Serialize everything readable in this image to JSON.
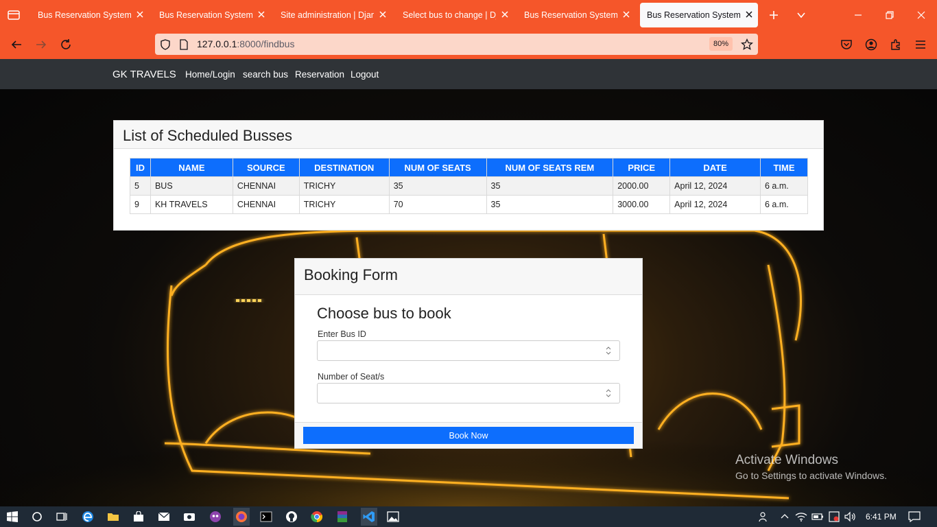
{
  "browser": {
    "tabs": [
      {
        "label": "Bus Reservation System in",
        "active": false
      },
      {
        "label": "Bus Reservation System in",
        "active": false
      },
      {
        "label": "Site administration | Django",
        "active": false
      },
      {
        "label": "Select bus to change | Djan",
        "active": false
      },
      {
        "label": "Bus Reservation System in",
        "active": false
      },
      {
        "label": "Bus Reservation System in",
        "active": true
      }
    ],
    "url_host": "127.0.0.1",
    "url_path": ":8000/findbus",
    "zoom": "80%",
    "theme_color": "#f5562a"
  },
  "site": {
    "brand": "GK TRAVELS",
    "nav": [
      "Home/Login",
      "search bus",
      "Reservation",
      "Logout"
    ]
  },
  "bus_list": {
    "title": "List of Scheduled Busses",
    "columns": [
      "ID",
      "NAME",
      "SOURCE",
      "DESTINATION",
      "NUM OF SEATS",
      "NUM OF SEATS REM",
      "PRICE",
      "DATE",
      "TIME"
    ],
    "rows": [
      [
        "5",
        "BUS",
        "CHENNAI",
        "TRICHY",
        "35",
        "35",
        "2000.00",
        "April 12, 2024",
        "6 a.m."
      ],
      [
        "9",
        "KH TRAVELS",
        "CHENNAI",
        "TRICHY",
        "70",
        "35",
        "3000.00",
        "April 12, 2024",
        "6 a.m."
      ]
    ],
    "header_color": "#0d6efd"
  },
  "booking_form": {
    "title": "Booking Form",
    "subtitle": "Choose bus to book",
    "bus_id_label": "Enter Bus ID",
    "bus_id_value": "",
    "seats_label": "Number of Seat/s",
    "seats_value": "",
    "submit_label": "Book Now"
  },
  "watermark": {
    "line1": "Activate Windows",
    "line2": "Go to Settings to activate Windows."
  },
  "taskbar": {
    "time": "6:41 PM"
  }
}
